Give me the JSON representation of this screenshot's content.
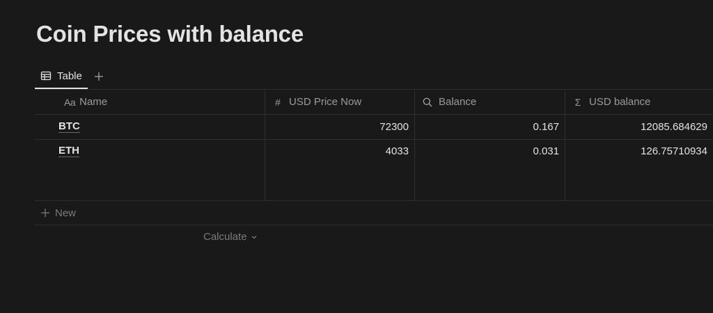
{
  "page": {
    "title": "Coin Prices with balance"
  },
  "views": {
    "active_tab_label": "Table",
    "tab_icon": "table-icon",
    "add_icon": "plus-icon"
  },
  "table": {
    "columns": [
      {
        "label": "Name",
        "type_icon": "Aa"
      },
      {
        "label": "USD Price Now",
        "type_icon": "#"
      },
      {
        "label": "Balance",
        "type_icon": "search-icon"
      },
      {
        "label": "USD balance",
        "type_icon": "Σ"
      }
    ],
    "rows": [
      {
        "name": "BTC",
        "usd_price_now": "72300",
        "balance": "0.167",
        "usd_balance": "12085.684629"
      },
      {
        "name": "ETH",
        "usd_price_now": "4033",
        "balance": "0.031",
        "usd_balance": "126.75710934"
      }
    ],
    "new_label": "New",
    "calculate_label": "Calculate"
  },
  "colors": {
    "background": "#191919",
    "text_primary": "#e3e3e3",
    "text_secondary": "#9b9b9b",
    "border": "#2f2f2f"
  }
}
